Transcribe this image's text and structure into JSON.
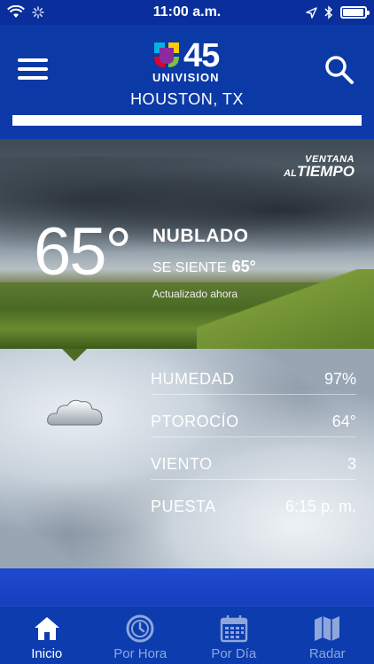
{
  "status_bar": {
    "time": "11:00 a.m."
  },
  "header": {
    "station_number": "45",
    "brand": "UNIVISION",
    "location": "HOUSTON, TX"
  },
  "hero": {
    "temperature": "65°",
    "condition": "NUBLADO",
    "feels_like_label": "SE SIENTE",
    "feels_like_value": "65°",
    "updated": "Actualizado ahora",
    "badge_line1": "VENTANA",
    "badge_line2_prefix": "AL",
    "badge_line2": "TIEMPO"
  },
  "details": [
    {
      "label": "HUMEDAD",
      "value": "97%"
    },
    {
      "label": "PTOROCÍO",
      "value": "64°"
    },
    {
      "label": "VIENTO",
      "value": "3"
    },
    {
      "label": "PUESTA",
      "value": "6:15 p. m."
    }
  ],
  "tabs": [
    {
      "label": "Inicio",
      "icon": "home-icon",
      "active": true
    },
    {
      "label": "Por Hora",
      "icon": "clock-icon",
      "active": false
    },
    {
      "label": "Por Día",
      "icon": "calendar-icon",
      "active": false
    },
    {
      "label": "Radar",
      "icon": "map-icon",
      "active": false
    }
  ],
  "colors": {
    "header_bg": "#0b39a6",
    "tab_active": "#ffffff",
    "tab_inactive": "#8ea6dc"
  }
}
